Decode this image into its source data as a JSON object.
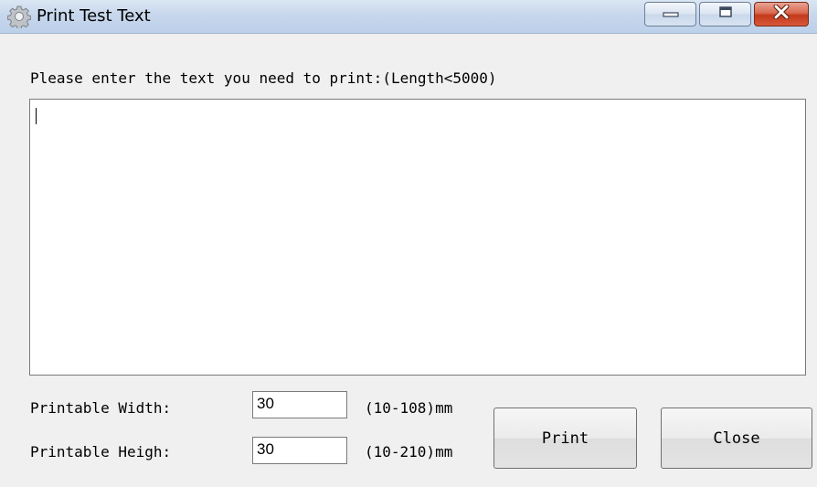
{
  "window": {
    "title": "Print Test Text",
    "icon": "gear-icon",
    "controls": {
      "minimize": "minimize-icon",
      "maximize": "maximize-icon",
      "close": "close-icon",
      "close_color": "#c4391b"
    }
  },
  "form": {
    "prompt": "Please enter the text you need to print:(Length<5000)",
    "text_value": "",
    "width_label": "Printable Width:",
    "width_value": "30",
    "width_range": "(10-108)mm",
    "height_label": "Printable Heigh:",
    "height_value": "30",
    "height_range": "(10-210)mm"
  },
  "buttons": {
    "print": "Print",
    "close": "Close"
  }
}
